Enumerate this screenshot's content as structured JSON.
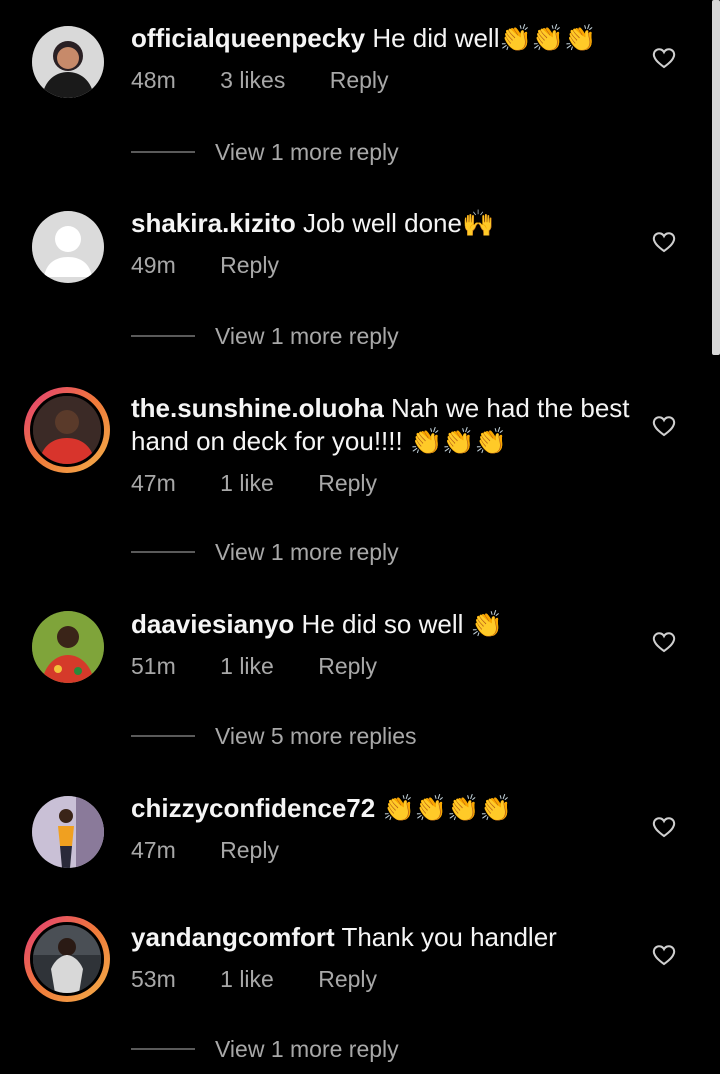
{
  "comments": [
    {
      "user": "officialqueenpecky",
      "text": "He did well",
      "emoji": "👏👏👏",
      "time": "48m",
      "likes": "3 likes",
      "reply": "Reply",
      "more": "View 1 more reply"
    },
    {
      "user": "shakira.kizito",
      "text": "Job well done",
      "emoji": "🙌",
      "time": "49m",
      "likes": "",
      "reply": "Reply",
      "more": "View 1 more reply"
    },
    {
      "user": "the.sunshine.oluoha",
      "text": "Nah we had the best hand on deck for you!!!!",
      "emoji": "👏👏👏",
      "time": "47m",
      "likes": "1 like",
      "reply": "Reply",
      "more": "View 1 more reply"
    },
    {
      "user": "daaviesianyo",
      "text": "He did so well",
      "emoji": "👏",
      "time": "51m",
      "likes": "1 like",
      "reply": "Reply",
      "more": "View 5 more replies"
    },
    {
      "user": "chizzyconfidence72",
      "text": "",
      "emoji": "👏👏👏👏",
      "time": "47m",
      "likes": "",
      "reply": "Reply",
      "more": ""
    },
    {
      "user": "yandangcomfort",
      "text": "Thank you handler",
      "emoji": "",
      "time": "53m",
      "likes": "1 like",
      "reply": "Reply",
      "more": "View 1 more reply"
    }
  ],
  "icons": {
    "like": "heart-outline-icon",
    "clap": "clapping-hands-emoji",
    "raised": "raised-hands-emoji"
  },
  "colors": {
    "background": "#000000",
    "text": "#f5f5f5",
    "muted": "#a8a8a8",
    "story_ring": "#e23a7a"
  }
}
